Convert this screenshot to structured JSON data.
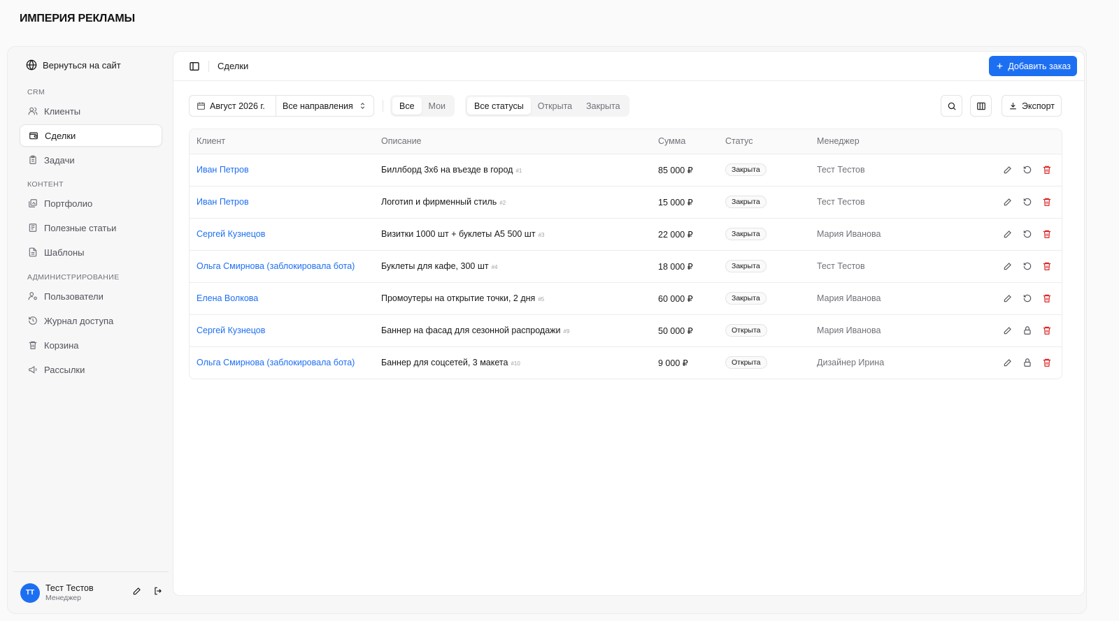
{
  "brand": "ИМПЕРИЯ РЕКЛАМЫ",
  "sidebar": {
    "back_label": "Вернуться на сайт",
    "groups": [
      {
        "label": "CRM",
        "items": [
          {
            "label": "Клиенты"
          },
          {
            "label": "Сделки"
          },
          {
            "label": "Задачи"
          }
        ]
      },
      {
        "label": "КОНТЕНТ",
        "items": [
          {
            "label": "Портфолио"
          },
          {
            "label": "Полезные статьи"
          },
          {
            "label": "Шаблоны"
          }
        ]
      },
      {
        "label": "АДМИНИСТРИРОВАНИЕ",
        "items": [
          {
            "label": "Пользователи"
          },
          {
            "label": "Журнал доступа"
          },
          {
            "label": "Корзина"
          },
          {
            "label": "Рассылки"
          }
        ]
      }
    ],
    "user": {
      "initials": "ТТ",
      "name": "Тест Тестов",
      "role": "Менеджер"
    }
  },
  "header": {
    "title": "Сделки",
    "add_label": "Добавить заказ"
  },
  "toolbar": {
    "date_label": "Август 2026 г.",
    "direction_label": "Все направления",
    "scope": [
      {
        "label": "Все"
      },
      {
        "label": "Мои"
      }
    ],
    "status_filter": [
      {
        "label": "Все статусы"
      },
      {
        "label": "Открыта"
      },
      {
        "label": "Закрыта"
      }
    ],
    "export_label": "Экспорт"
  },
  "table": {
    "columns": [
      "Клиент",
      "Описание",
      "Сумма",
      "Статус",
      "Менеджер"
    ],
    "rows": [
      {
        "client": "Иван Петров",
        "description": "Биллборд 3х6 на въезде в город",
        "num": "#1",
        "amount": "85 000 ₽",
        "status": "Закрыта",
        "manager": "Тест Тестов"
      },
      {
        "client": "Иван Петров",
        "description": "Логотип и фирменный стиль",
        "num": "#2",
        "amount": "15 000 ₽",
        "status": "Закрыта",
        "manager": "Тест Тестов"
      },
      {
        "client": "Сергей Кузнецов",
        "description": "Визитки 1000 шт + буклеты А5 500 шт",
        "num": "#3",
        "amount": "22 000 ₽",
        "status": "Закрыта",
        "manager": "Мария Иванова"
      },
      {
        "client": "Ольга Смирнова (заблокировала бота)",
        "description": "Буклеты для кафе, 300 шт",
        "num": "#4",
        "amount": "18 000 ₽",
        "status": "Закрыта",
        "manager": "Тест Тестов"
      },
      {
        "client": "Елена Волкова",
        "description": "Промоутеры на открытие точки, 2 дня",
        "num": "#5",
        "amount": "60 000 ₽",
        "status": "Закрыта",
        "manager": "Мария Иванова"
      },
      {
        "client": "Сергей Кузнецов",
        "description": "Баннер на фасад для сезонной распродажи",
        "num": "#9",
        "amount": "50 000 ₽",
        "status": "Открыта",
        "manager": "Мария Иванова"
      },
      {
        "client": "Ольга Смирнова (заблокировала бота)",
        "description": "Баннер для соцсетей, 3 макета",
        "num": "#10",
        "amount": "9 000 ₽",
        "status": "Открыта",
        "manager": "Дизайнер Ирина"
      }
    ]
  },
  "colors": {
    "accent": "#1d6ff2",
    "danger": "#dc2626"
  }
}
